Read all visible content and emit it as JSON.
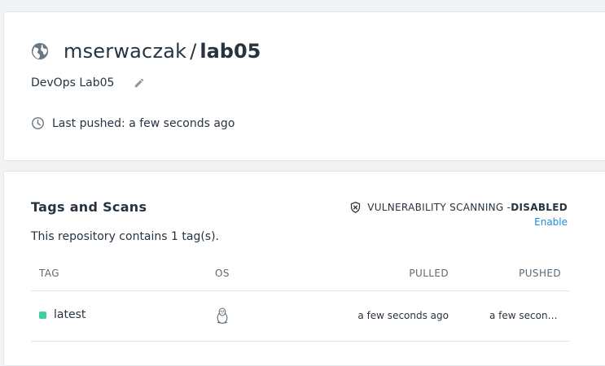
{
  "repository": {
    "owner": "mserwaczak",
    "separator": "/",
    "name": "lab05",
    "description": "DevOps Lab05",
    "last_pushed": "Last pushed: a few seconds ago"
  },
  "tags_section": {
    "title": "Tags and Scans",
    "count_text": "This repository contains 1 tag(s).",
    "vulnerability_label": "VULNERABILITY SCANNING - ",
    "vulnerability_status": "DISABLED",
    "enable_label": "Enable",
    "columns": {
      "tag": "TAG",
      "os": "OS",
      "pulled": "PULLED",
      "pushed": "PUSHED"
    },
    "rows": [
      {
        "tag": "latest",
        "os_icon": "linux-icon",
        "pulled": "a few seconds ago",
        "pushed": "a few seconds ago"
      }
    ]
  },
  "colors": {
    "accent": "#1d8ad9",
    "status_dot": "#3ecf9f",
    "text": "#27343f"
  }
}
